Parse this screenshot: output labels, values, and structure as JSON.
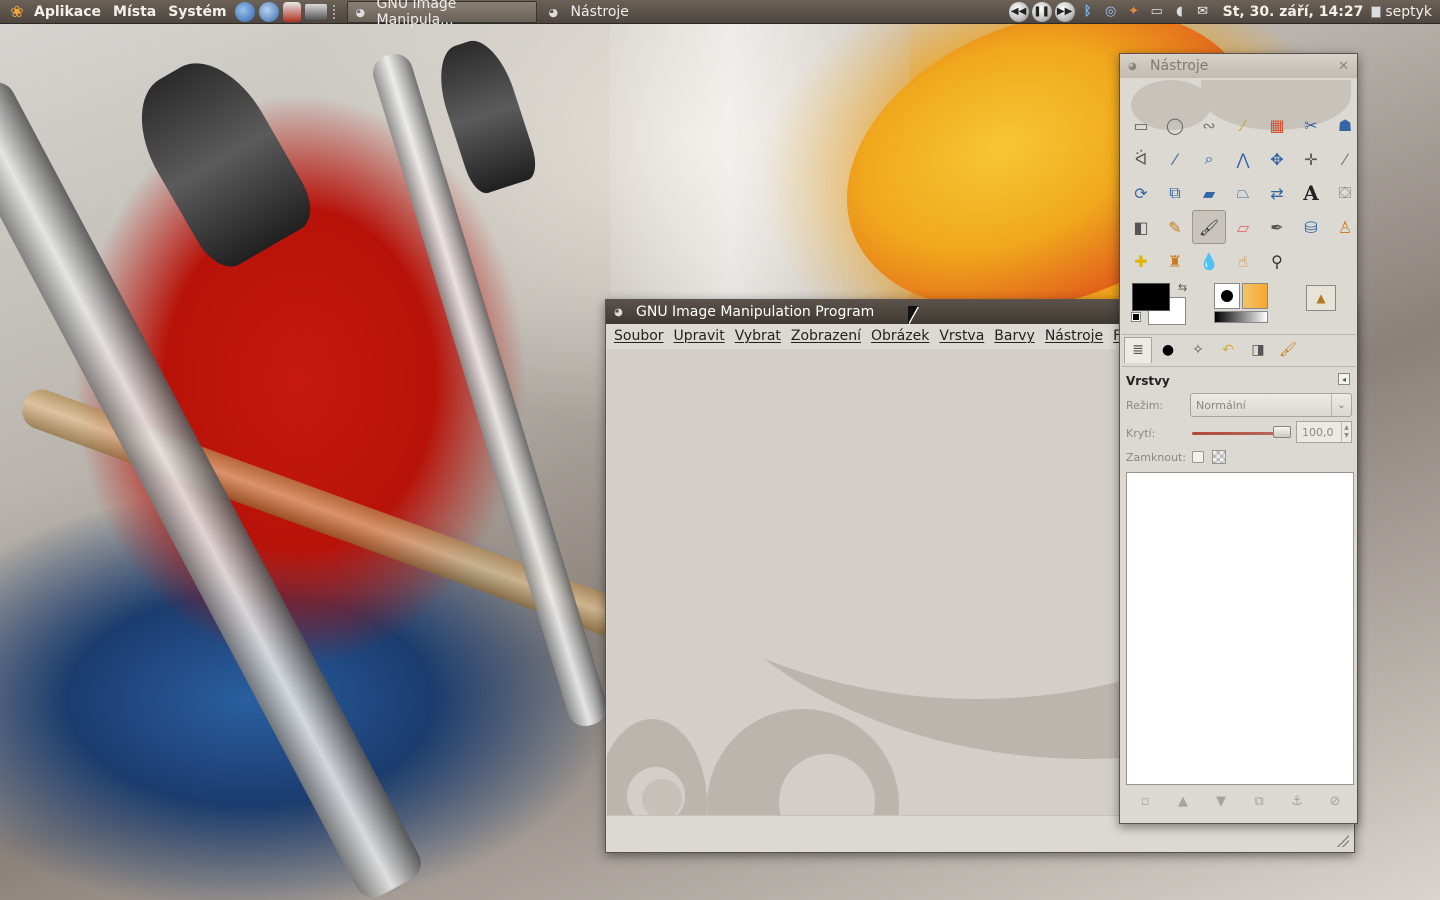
{
  "panel": {
    "menus": [
      "Aplikace",
      "Místa",
      "Systém"
    ],
    "tasks": [
      {
        "label": "GNU Image Manipula...",
        "active": true
      },
      {
        "label": "Nástroje",
        "active": false
      }
    ],
    "clock": "St, 30. září, 14:27",
    "user": "septyk",
    "tray_icons": [
      "prev-track-icon",
      "pause-icon",
      "next-track-icon",
      "bluetooth-icon",
      "network-icon",
      "update-icon",
      "battery-icon",
      "volume-icon",
      "mail-icon"
    ]
  },
  "gimp_window": {
    "title": "GNU Image Manipulation Program",
    "menu": [
      "Soubor",
      "Upravit",
      "Vybrat",
      "Zobrazení",
      "Obrázek",
      "Vrstva",
      "Barvy",
      "Nástroje",
      "Filtry"
    ]
  },
  "toolbox": {
    "title": "Nástroje",
    "tools": [
      "rect-select-icon",
      "ellipse-select-icon",
      "free-select-icon",
      "fuzzy-select-icon",
      "select-by-color-icon",
      "scissors-icon",
      "foreground-select-icon",
      "paths-icon",
      "color-picker-icon",
      "zoom-icon",
      "measure-icon",
      "move-icon",
      "align-icon",
      "crop-icon",
      "rotate-icon",
      "scale-icon",
      "shear-icon",
      "perspective-icon",
      "flip-icon",
      "text-icon",
      "bucket-fill-icon",
      "blend-icon",
      "pencil-icon",
      "paintbrush-icon",
      "eraser-icon",
      "airbrush-icon",
      "ink-icon",
      "clone-icon",
      "heal-icon",
      "perspective-clone-icon",
      "blur-icon",
      "smudge-icon",
      "dodge-burn-icon"
    ],
    "selected_tool": "paintbrush-icon",
    "colors": {
      "foreground": "#000000",
      "background": "#ffffff"
    },
    "dock_tabs": [
      "layers-tab-icon",
      "brushes-tab-icon",
      "paths-tab-icon",
      "undo-tab-icon",
      "gradients-tab-icon",
      "tool-options-tab-icon"
    ],
    "layers": {
      "title": "Vrstvy",
      "mode_label": "Režim:",
      "mode_value": "Normální",
      "opacity_label": "Krytí:",
      "opacity_value": "100,0",
      "opacity_fraction": 1.0,
      "lock_label": "Zamknout:"
    },
    "layer_actions": [
      "new-layer-icon",
      "raise-layer-icon",
      "lower-layer-icon",
      "duplicate-layer-icon",
      "anchor-layer-icon",
      "delete-layer-icon"
    ]
  }
}
